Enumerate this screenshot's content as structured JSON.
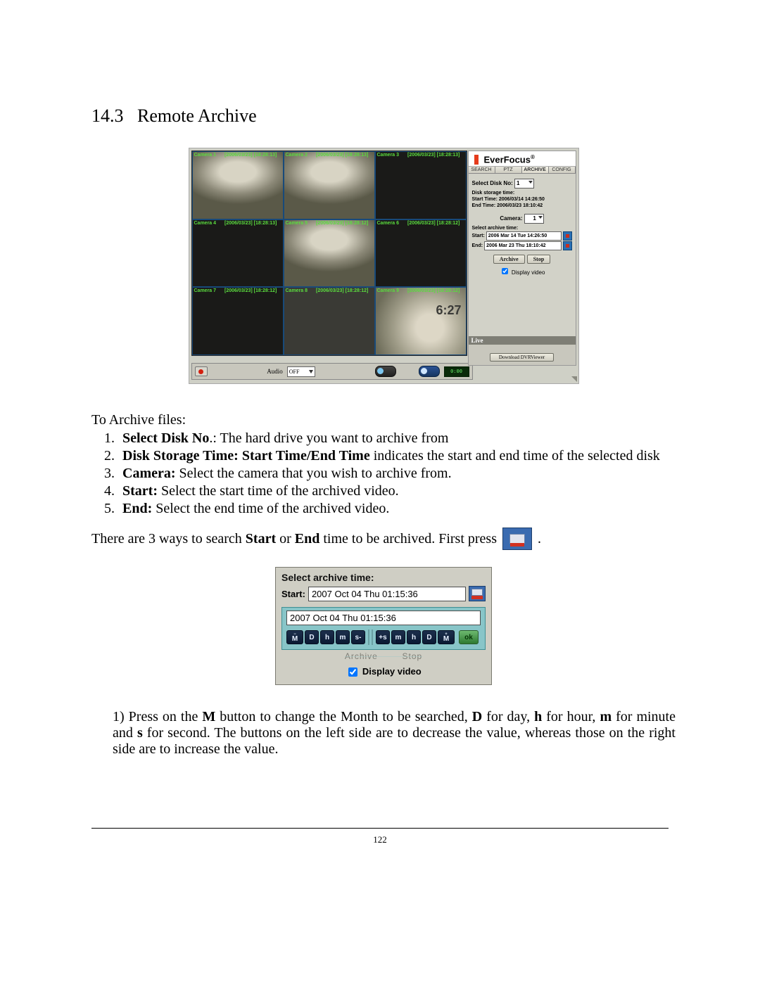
{
  "section": {
    "number": "14.3",
    "title": "Remote Archive"
  },
  "screenshot": {
    "logo_text": "EverFocus",
    "logo_reg": "®",
    "tabs": {
      "search": "SEARCH",
      "ptz": "PTZ",
      "archive": "ARCHIVE",
      "config": "CONFIG"
    },
    "select_disk_label": "Select Disk No:",
    "select_disk_value": "1",
    "disk_storage_label": "Disk storage time:",
    "start_time_line": "Start Time: 2006/03/14 14:26:50",
    "end_time_line": "End Time:  2006/03/23 18:10:42",
    "camera_label": "Camera:",
    "camera_value": "1",
    "select_archive_label": "Select archive time:",
    "start_label": "Start:",
    "start_value": "2006 Mar 14 Tue 14:26:50",
    "end_label": "End:",
    "end_value": "2006 Mar 23 Thu 18:10:42",
    "archive_btn": "Archive",
    "stop_btn": "Stop",
    "display_video": "Display video",
    "live": "Live",
    "download": "Download DVRViewer",
    "audio_label": "Audio",
    "audio_value": "OFF",
    "lcd": "0:00",
    "cams": [
      {
        "name": "Camera 1",
        "ts": "[2006/03/23] [18:28:13]"
      },
      {
        "name": "Camera 2",
        "ts": "[2006/03/23] [18:28:13]"
      },
      {
        "name": "Camera 3",
        "ts": "[2006/03/23] [18:28:13]"
      },
      {
        "name": "Camera 4",
        "ts": "[2006/03/23] [18:28:13]"
      },
      {
        "name": "Camera 5",
        "ts": "[2006/03/23] [18:28:12]"
      },
      {
        "name": "Camera 6",
        "ts": "[2006/03/23] [18:28:12]"
      },
      {
        "name": "Camera 7",
        "ts": "[2006/03/23] [18:28:12]"
      },
      {
        "name": "Camera 8",
        "ts": "[2006/03/23] [18:28:12]"
      },
      {
        "name": "Camera 9",
        "ts": "[2006/03/23] [18:28:12]"
      }
    ]
  },
  "body": {
    "lead": "To Archive files:",
    "steps": [
      {
        "bold": "Select Disk No",
        "rest": ".: The hard drive you want to archive from"
      },
      {
        "bold": "Disk Storage Time: Start Time/End Time",
        "rest": " indicates the start and end time of the selected disk"
      },
      {
        "bold": "Camera:",
        "rest": " Select the camera that you wish to archive from."
      },
      {
        "bold": "Start:",
        "rest": " Select the start time of the archived video."
      },
      {
        "bold": "End:",
        "rest": " Select the end time of the archived video."
      }
    ],
    "ways_a": "There are 3 ways to search ",
    "ways_b": "Start",
    "ways_c": " or ",
    "ways_d": "End",
    "ways_e": " time to be archived. First press",
    "ways_f": "."
  },
  "sat": {
    "title": "Select archive time:",
    "start_label": "Start:",
    "start_value": "2007 Oct 04 Thu 01:15:36",
    "drop_value": "2007 Oct 04 Thu 01:15:36",
    "keys_left": [
      "M",
      "D",
      "h",
      "m",
      "s-"
    ],
    "keys_right": [
      "+s",
      "m",
      "h",
      "D",
      "M"
    ],
    "ok": "ok",
    "faded_left": "Archive",
    "faded_right": "Stop",
    "display_video": "Display video"
  },
  "para1_plain_a": "1) Press on the ",
  "para1_M": "M",
  "para1_b": " button to change the Month to be searched, ",
  "para1_D": "D",
  "para1_c": " for day, ",
  "para1_h": "h",
  "para1_d": " for hour, ",
  "para1_m": "m",
  "para1_e": " for minute and ",
  "para1_s": "s",
  "para1_f": " for second. The buttons on the left side are to decrease the value, whereas those on the right side are to increase the value.",
  "page_number": "122"
}
